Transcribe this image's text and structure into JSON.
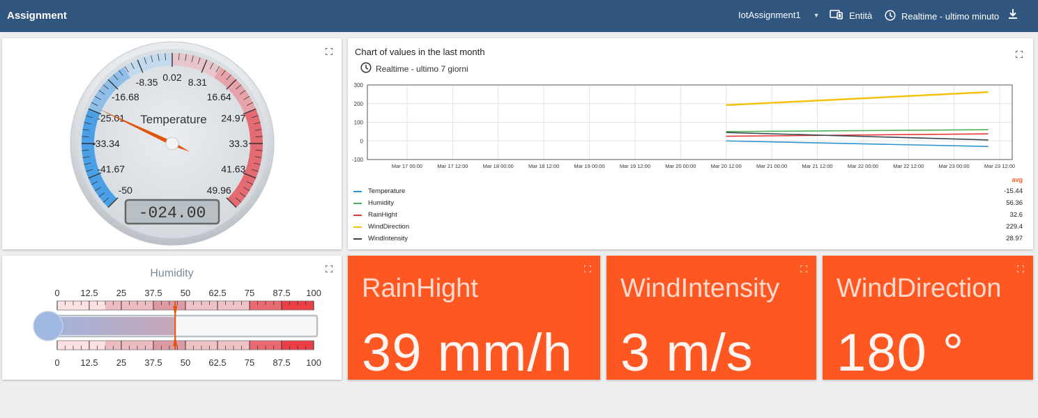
{
  "header": {
    "title": "Assignment",
    "entity_selector": "IotAssignment1",
    "entities_label": "Entità",
    "timewindow_label": "Realtime - ultimo minuto"
  },
  "icons": {
    "expand": "fullscreen-icon",
    "entities": "devices-icon",
    "time": "clock-icon",
    "download": "download-icon"
  },
  "colors": {
    "header": "#305680",
    "accent": "#ff5722",
    "temperature": "#2e91d1",
    "humidity": "#4caf50",
    "rainhight": "#e53935",
    "winddirection": "#f4c20d",
    "windintensity": "#37474f"
  },
  "temperature_gauge": {
    "title": "Temperature",
    "ticks": [
      "-50",
      "-41.67",
      "-33.34",
      "-25.01",
      "-16.68",
      "-8.35",
      "0.02",
      "8.31",
      "16.64",
      "24.97",
      "33.3",
      "41.63",
      "49.96"
    ],
    "min": -50,
    "max": 49.96,
    "value": -24.0,
    "display": "-024.00"
  },
  "humidity_gauge": {
    "title": "Humidity",
    "ticks": [
      "0",
      "12.5",
      "25",
      "37.5",
      "50",
      "62.5",
      "75",
      "87.5",
      "100"
    ],
    "min": 0,
    "max": 100,
    "value": 46
  },
  "chart": {
    "title": "Chart of values in the last month",
    "timewindow": "Realtime - ultimo 7 giorni",
    "legend_header": "avg"
  },
  "chart_data": {
    "type": "line",
    "title": "Chart of values in the last month",
    "ylim": [
      -100,
      300
    ],
    "y_ticks": [
      "300",
      "200",
      "100",
      "0",
      "-100"
    ],
    "x_ticks": [
      "Mar 17 00:00",
      "Mar 17 12:00",
      "Mar 18 00:00",
      "Mar 18 12:00",
      "Mar 19 00:00",
      "Mar 19 12:00",
      "Mar 20 00:00",
      "Mar 20 12:00",
      "Mar 21 00:00",
      "Mar 21 12:00",
      "Mar 22 00:00",
      "Mar 22 12:00",
      "Mar 23 00:00",
      "Mar 23 12:00"
    ],
    "x_hours_from_first_tick": [
      0,
      12,
      24,
      36,
      48,
      60,
      72,
      84,
      96,
      108,
      120,
      132,
      144,
      156
    ],
    "grid": true,
    "legend": "bottom",
    "series": [
      {
        "name": "Temperature",
        "color": "#2e91d1",
        "avg": "-15.44",
        "x": [
          "Mar 20 12:00",
          "Mar 23 09:00"
        ],
        "values": [
          0,
          -30
        ]
      },
      {
        "name": "Humidity",
        "color": "#4caf50",
        "avg": "56.36",
        "x": [
          "Mar 20 12:00",
          "Mar 23 09:00"
        ],
        "values": [
          50,
          60
        ]
      },
      {
        "name": "RainHight",
        "color": "#e53935",
        "avg": "32.6",
        "x": [
          "Mar 20 12:00",
          "Mar 23 09:00"
        ],
        "values": [
          25,
          38
        ]
      },
      {
        "name": "WindDirection",
        "color": "#f4c20d",
        "avg": "229.4",
        "x": [
          "Mar 20 12:00",
          "Mar 23 09:00"
        ],
        "values": [
          192,
          262
        ]
      },
      {
        "name": "WindIntensity",
        "color": "#37474f",
        "avg": "28.97",
        "x": [
          "Mar 20 12:00",
          "Mar 23 09:00"
        ],
        "values": [
          45,
          5
        ]
      }
    ]
  },
  "cards": {
    "rain": {
      "label": "RainHight",
      "value": "39 mm/h"
    },
    "wind_intensity": {
      "label": "WindIntensity",
      "value": "3 m/s"
    },
    "wind_direction": {
      "label": "WindDirection",
      "value": "180 °"
    }
  }
}
